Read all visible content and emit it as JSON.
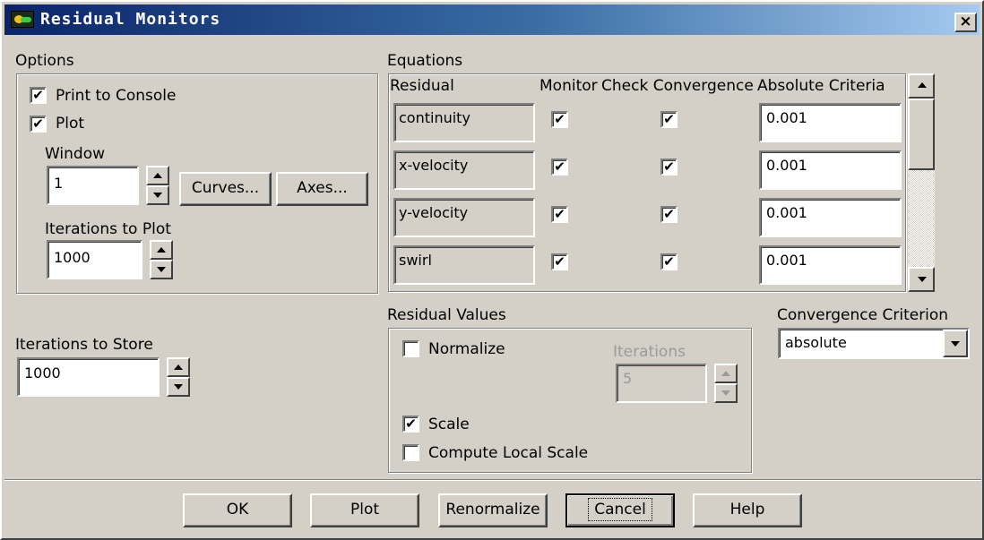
{
  "window": {
    "title": "Residual Monitors",
    "close_glyph": "×"
  },
  "options": {
    "label": "Options",
    "print_to_console": {
      "label": "Print to Console",
      "checked": true
    },
    "plot": {
      "label": "Plot",
      "checked": true
    },
    "window_label": "Window",
    "window_value": "1",
    "curves_button": "Curves...",
    "axes_button": "Axes...",
    "iterations_to_plot_label": "Iterations to Plot",
    "iterations_to_plot_value": "1000"
  },
  "iterations_to_store": {
    "label": "Iterations to Store",
    "value": "1000"
  },
  "equations": {
    "label": "Equations",
    "headers": [
      "Residual",
      "Monitor",
      "Check Convergence",
      "Absolute Criteria"
    ],
    "rows": [
      {
        "residual": "continuity",
        "monitor": true,
        "check": true,
        "criteria": "0.001"
      },
      {
        "residual": "x-velocity",
        "monitor": true,
        "check": true,
        "criteria": "0.001"
      },
      {
        "residual": "y-velocity",
        "monitor": true,
        "check": true,
        "criteria": "0.001"
      },
      {
        "residual": "swirl",
        "monitor": true,
        "check": true,
        "criteria": "0.001"
      }
    ]
  },
  "residual_values": {
    "label": "Residual Values",
    "normalize": {
      "label": "Normalize",
      "checked": false
    },
    "iterations_label": "Iterations",
    "iterations_value": "5",
    "scale": {
      "label": "Scale",
      "checked": true
    },
    "compute_local_scale": {
      "label": "Compute Local Scale",
      "checked": false
    }
  },
  "convergence_criterion": {
    "label": "Convergence Criterion",
    "value": "absolute"
  },
  "buttons": {
    "ok": "OK",
    "plot": "Plot",
    "renormalize": "Renormalize",
    "cancel": "Cancel",
    "help": "Help"
  },
  "check_glyph": "✔"
}
